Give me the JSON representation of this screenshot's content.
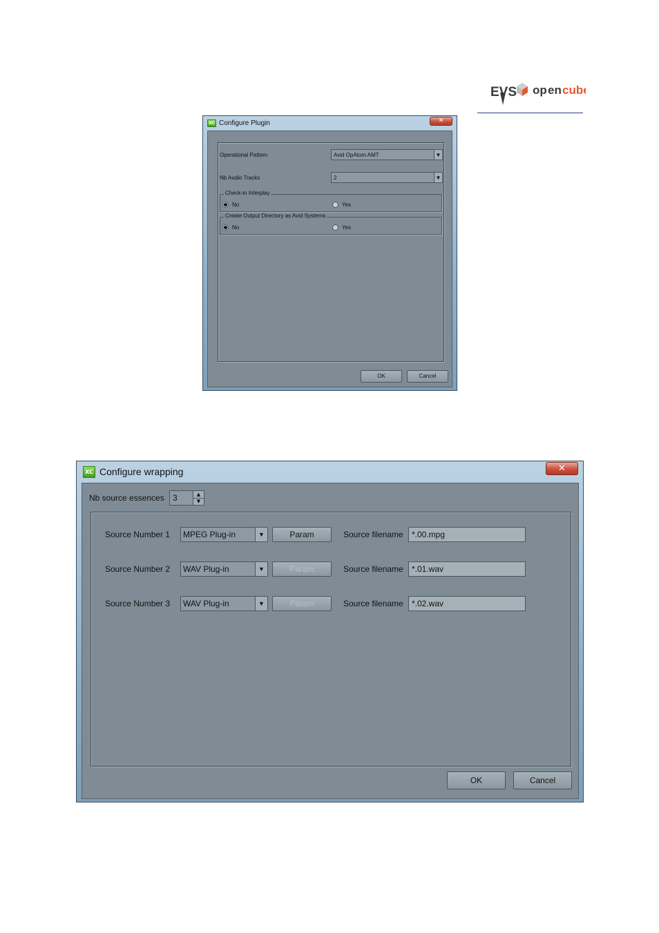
{
  "logo": {
    "brand": "EVS",
    "product": "opencube",
    "colors": {
      "evs": "#3a3a3a",
      "cube": "#e8582a",
      "open": "#3a3a3a"
    }
  },
  "plugin_dialog": {
    "title": "Configure Plugin",
    "operational_pattern": {
      "label": "Operational Pattern",
      "value": "Avid OpAtom AMT"
    },
    "audio_tracks": {
      "label": "Nb Audio Tracks",
      "value": "2"
    },
    "checkin": {
      "label": "Check-in Interplay",
      "options": [
        "No",
        "Yes"
      ],
      "selected": "No"
    },
    "output_dir": {
      "label": "Create Output Directory as Avid Systems",
      "options": [
        "No",
        "Yes"
      ],
      "selected": "No"
    },
    "ok_label": "OK",
    "cancel_label": "Cancel"
  },
  "wrapping_dialog": {
    "title": "Configure wrapping",
    "nb_sources": {
      "label": "Nb source essences",
      "value": "3"
    },
    "sources": [
      {
        "label": "Source Number 1",
        "plugin": "MPEG Plug-in",
        "param_label": "Param",
        "param_enabled": true,
        "filename_label": "Source filename",
        "filename": "*.00.mpg"
      },
      {
        "label": "Source Number 2",
        "plugin": "WAV Plug-in",
        "param_label": "Param",
        "param_enabled": false,
        "filename_label": "Source filename",
        "filename": "*.01.wav"
      },
      {
        "label": "Source Number 3",
        "plugin": "WAV Plug-in",
        "param_label": "Param",
        "param_enabled": false,
        "filename_label": "Source filename",
        "filename": "*.02.wav"
      }
    ],
    "ok_label": "OK",
    "cancel_label": "Cancel"
  },
  "icons": {
    "close": "close-icon",
    "app": "app-icon",
    "dropdown": "chevron-down-icon",
    "spin": "spin-arrows-icon"
  }
}
